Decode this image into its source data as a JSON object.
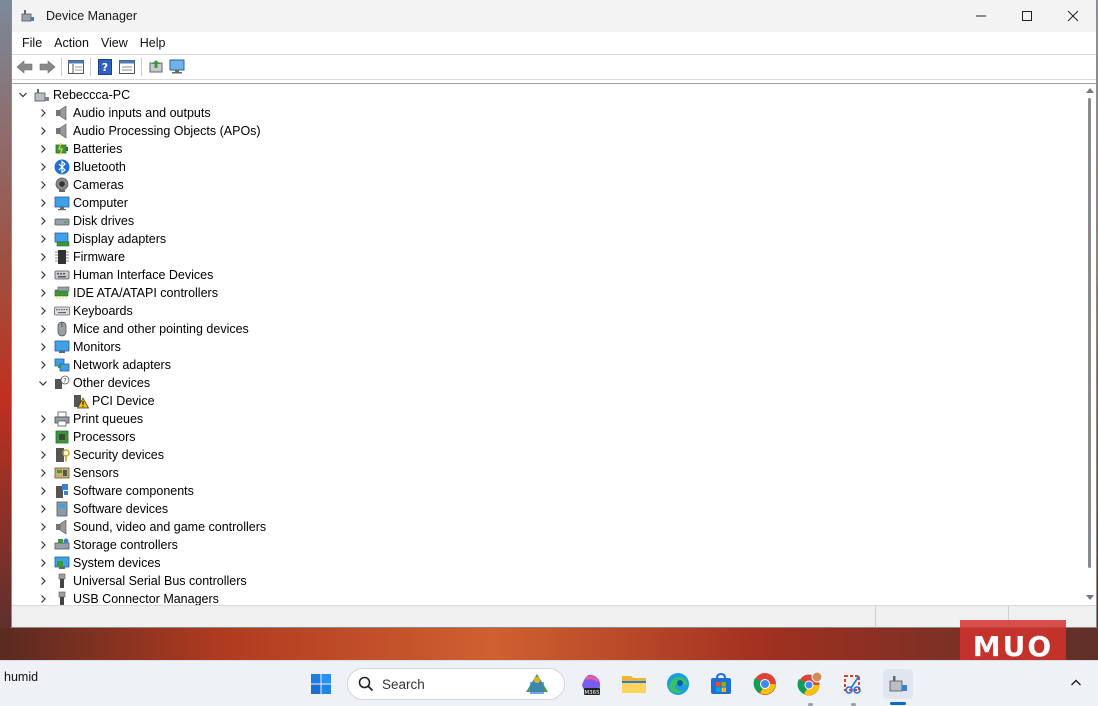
{
  "window": {
    "title": "Device Manager"
  },
  "menu": [
    "File",
    "Action",
    "View",
    "Help"
  ],
  "tree": {
    "root": "Rebeccca-PC",
    "items": [
      {
        "label": "Audio inputs and outputs",
        "icon": "speaker-icon",
        "expanded": false
      },
      {
        "label": "Audio Processing Objects (APOs)",
        "icon": "speaker-icon",
        "expanded": false
      },
      {
        "label": "Batteries",
        "icon": "battery-icon",
        "expanded": false
      },
      {
        "label": "Bluetooth",
        "icon": "bluetooth-icon",
        "expanded": false
      },
      {
        "label": "Cameras",
        "icon": "camera-icon",
        "expanded": false
      },
      {
        "label": "Computer",
        "icon": "computer-icon",
        "expanded": false
      },
      {
        "label": "Disk drives",
        "icon": "disk-drive-icon",
        "expanded": false
      },
      {
        "label": "Display adapters",
        "icon": "display-adapter-icon",
        "expanded": false
      },
      {
        "label": "Firmware",
        "icon": "firmware-icon",
        "expanded": false
      },
      {
        "label": "Human Interface Devices",
        "icon": "hid-icon",
        "expanded": false
      },
      {
        "label": "IDE ATA/ATAPI controllers",
        "icon": "ide-controller-icon",
        "expanded": false
      },
      {
        "label": "Keyboards",
        "icon": "keyboard-icon",
        "expanded": false
      },
      {
        "label": "Mice and other pointing devices",
        "icon": "mouse-icon",
        "expanded": false
      },
      {
        "label": "Monitors",
        "icon": "monitor-icon",
        "expanded": false
      },
      {
        "label": "Network adapters",
        "icon": "network-adapter-icon",
        "expanded": false
      },
      {
        "label": "Other devices",
        "icon": "unknown-device-icon",
        "expanded": true,
        "children": [
          {
            "label": "PCI Device",
            "icon": "warning-device-icon"
          }
        ]
      },
      {
        "label": "Print queues",
        "icon": "printer-icon",
        "expanded": false
      },
      {
        "label": "Processors",
        "icon": "processor-icon",
        "expanded": false
      },
      {
        "label": "Security devices",
        "icon": "security-device-icon",
        "expanded": false
      },
      {
        "label": "Sensors",
        "icon": "sensor-icon",
        "expanded": false
      },
      {
        "label": "Software components",
        "icon": "software-component-icon",
        "expanded": false
      },
      {
        "label": "Software devices",
        "icon": "software-device-icon",
        "expanded": false
      },
      {
        "label": "Sound, video and game controllers",
        "icon": "speaker-icon",
        "expanded": false
      },
      {
        "label": "Storage controllers",
        "icon": "storage-controller-icon",
        "expanded": false
      },
      {
        "label": "System devices",
        "icon": "system-device-icon",
        "expanded": false
      },
      {
        "label": "Universal Serial Bus controllers",
        "icon": "usb-icon",
        "expanded": false
      },
      {
        "label": "USB Connector Managers",
        "icon": "usb-icon",
        "expanded": false
      }
    ]
  },
  "taskbar": {
    "weather_text": "humid",
    "search_placeholder": "Search",
    "apps": [
      "start-icon",
      "copilot-m365-icon",
      "file-explorer-icon",
      "edge-icon",
      "store-icon",
      "chrome-icon",
      "chrome-profile-icon",
      "snipping-tool-icon",
      "device-manager-icon"
    ]
  },
  "watermark": "MUO",
  "colors": {
    "accent": "#0a67c8",
    "warning": "#f2c200",
    "watermark": "#d2322d"
  }
}
